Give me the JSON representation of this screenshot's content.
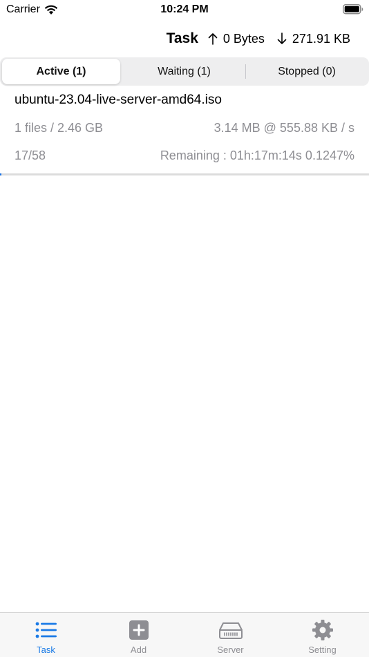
{
  "status_bar": {
    "carrier": "Carrier",
    "time": "10:24 PM"
  },
  "nav": {
    "title": "Task",
    "upload": "0 Bytes",
    "download": "271.91 KB"
  },
  "segments": [
    {
      "label": "Active (1)",
      "selected": true
    },
    {
      "label": "Waiting (1)",
      "selected": false
    },
    {
      "label": "Stopped (0)",
      "selected": false
    }
  ],
  "task": {
    "name": "ubuntu-23.04-live-server-amd64.iso",
    "files_size": "1 files / 2.46 GB",
    "speed": "3.14 MB @ 555.88 KB / s",
    "pieces": "17/58",
    "remaining": "Remaining : 01h:17m:14s  0.1247%",
    "progress_percent": 0.1247
  },
  "tabbar": {
    "items": [
      {
        "label": "Task",
        "icon": "list-icon",
        "active": true
      },
      {
        "label": "Add",
        "icon": "plus-square-icon",
        "active": false
      },
      {
        "label": "Server",
        "icon": "server-icon",
        "active": false
      },
      {
        "label": "Setting",
        "icon": "gear-icon",
        "active": false
      }
    ]
  },
  "colors": {
    "accent": "#1a7ae6",
    "inactive": "#8e8e93"
  }
}
